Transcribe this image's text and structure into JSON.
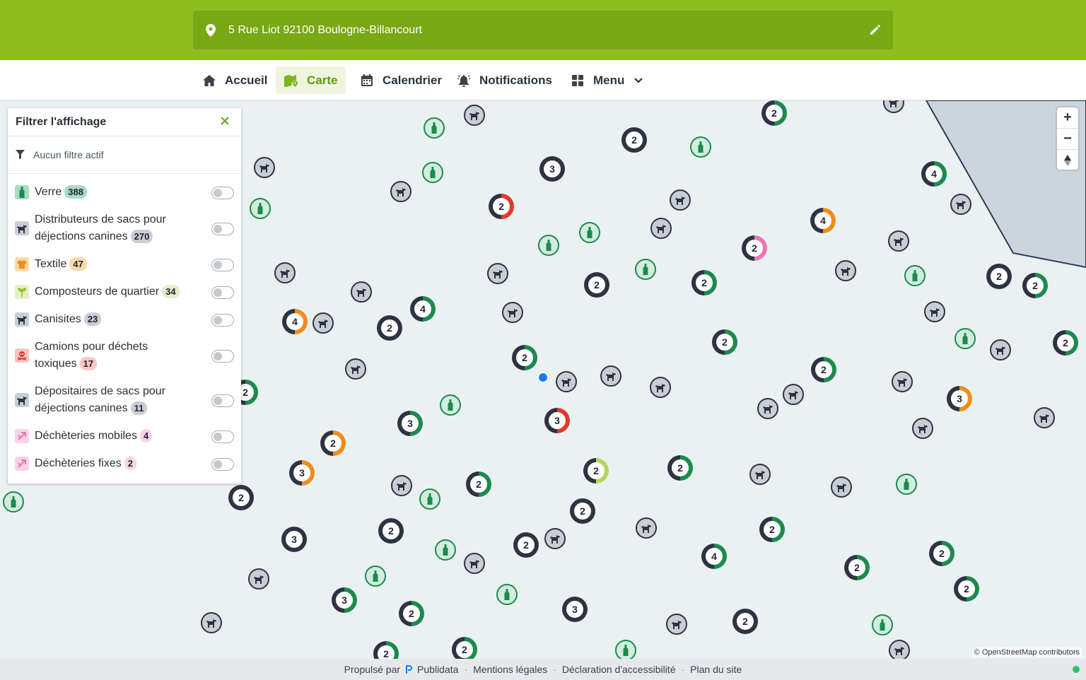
{
  "header": {
    "address": "5 Rue Liot 92100 Boulogne-Billancourt",
    "pin_icon": "map-pin-icon",
    "edit_icon": "pencil-icon",
    "brand_color": "#8dbd1f"
  },
  "nav": {
    "items": [
      {
        "label": "Accueil",
        "icon": "home-icon"
      },
      {
        "label": "Carte",
        "icon": "map-icon",
        "active": true
      },
      {
        "label": "Calendrier",
        "icon": "calendar-icon"
      },
      {
        "label": "Notifications",
        "icon": "bell-icon"
      },
      {
        "label": "Menu",
        "icon": "grid-icon"
      }
    ]
  },
  "filter_panel": {
    "title": "Filtrer l'affichage",
    "status": "Aucun filtre actif",
    "categories": [
      {
        "label": "Verre",
        "count": "388",
        "color": "#a8dcc0"
      },
      {
        "label": "Distributeurs de sacs pour déjections canines",
        "count": "270",
        "color": "#c9ced6"
      },
      {
        "label": "Textile",
        "count": "47",
        "color": "#fbd9a8"
      },
      {
        "label": "Composteurs de quartier",
        "count": "34",
        "color": "#e3f0c7"
      },
      {
        "label": "Canisites",
        "count": "23",
        "color": "#c9ced6"
      },
      {
        "label": "Camions pour déchets toxiques",
        "count": "17",
        "color": "#f8c6c4"
      },
      {
        "label": "Dépositaires de sacs pour déjections canines",
        "count": "11",
        "color": "#c9ced6"
      },
      {
        "label": "Déchèteries mobiles",
        "count": "4",
        "color": "#f9d3e8"
      },
      {
        "label": "Déchèteries fixes",
        "count": "2",
        "color": "#f9d3e8"
      }
    ]
  },
  "map": {
    "zoom_in": "+",
    "zoom_out": "−",
    "attribution": "© OpenStreetMap contributors",
    "clusters": [
      {
        "n": "2",
        "ring": "#1d8a4d"
      },
      {
        "n": "2",
        "ring": "#2d3341"
      },
      {
        "n": "3",
        "ring": "#2d3341"
      },
      {
        "n": "2",
        "ring": "#e0392b"
      },
      {
        "n": "4",
        "ring": "#1d8a4d"
      },
      {
        "n": "4",
        "ring": "#f28c1a"
      },
      {
        "n": "2",
        "ring": "#e978b3"
      },
      {
        "n": "2",
        "ring": "#2d3341"
      },
      {
        "n": "2",
        "ring": "#1d8a4d"
      },
      {
        "n": "2",
        "ring": "#2d3341"
      },
      {
        "n": "2",
        "ring": "#1d8a4d"
      },
      {
        "n": "4",
        "ring": "#f28c1a"
      },
      {
        "n": "4",
        "ring": "#1d8a4d"
      },
      {
        "n": "2",
        "ring": "#2d3341"
      },
      {
        "n": "2",
        "ring": "#1d8a4d"
      },
      {
        "n": "2",
        "ring": "#1d8a4d"
      },
      {
        "n": "2",
        "ring": "#1d8a4d"
      },
      {
        "n": "2",
        "ring": "#1d8a4d"
      },
      {
        "n": "3",
        "ring": "#f28c1a"
      },
      {
        "n": "3",
        "ring": "#e0392b"
      },
      {
        "n": "3",
        "ring": "#1d8a4d"
      },
      {
        "n": "2",
        "ring": "#f28c1a"
      },
      {
        "n": "3",
        "ring": "#f28c1a"
      },
      {
        "n": "2",
        "ring": "#b5d65c"
      },
      {
        "n": "2",
        "ring": "#1d8a4d"
      },
      {
        "n": "2",
        "ring": "#1d8a4d"
      },
      {
        "n": "2",
        "ring": "#2d3341"
      },
      {
        "n": "2",
        "ring": "#2d3341"
      },
      {
        "n": "2",
        "ring": "#2d3341"
      },
      {
        "n": "2",
        "ring": "#2d3341"
      },
      {
        "n": "3",
        "ring": "#2d3341"
      },
      {
        "n": "2",
        "ring": "#1d8a4d"
      },
      {
        "n": "4",
        "ring": "#1d8a4d"
      },
      {
        "n": "2",
        "ring": "#1d8a4d"
      },
      {
        "n": "2",
        "ring": "#1d8a4d"
      },
      {
        "n": "2",
        "ring": "#1d8a4d"
      },
      {
        "n": "3",
        "ring": "#1d8a4d"
      },
      {
        "n": "2",
        "ring": "#1d8a4d"
      },
      {
        "n": "3",
        "ring": "#2d3341"
      },
      {
        "n": "2",
        "ring": "#2d3341"
      },
      {
        "n": "2",
        "ring": "#1d8a4d"
      },
      {
        "n": "2",
        "ring": "#1d8a4d"
      },
      {
        "n": "2",
        "ring": "#1d8a4d"
      }
    ]
  },
  "footer": {
    "powered_by": "Propulsé par",
    "provider": "Publidata",
    "links": [
      "Mentions légales",
      "Déclaration d'accessibilité",
      "Plan du site"
    ]
  }
}
